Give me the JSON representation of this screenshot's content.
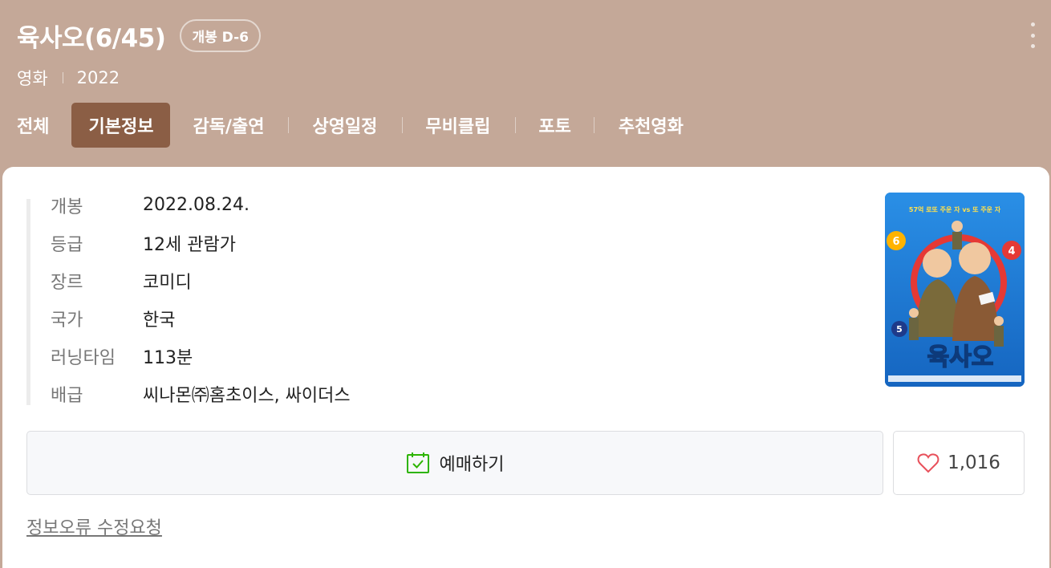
{
  "header": {
    "title": "육사오(6/45)",
    "dday_badge": "개봉 D-6",
    "category": "영화",
    "year": "2022"
  },
  "tabs": [
    {
      "label": "전체",
      "active": false
    },
    {
      "label": "기본정보",
      "active": true
    },
    {
      "label": "감독/출연",
      "active": false
    },
    {
      "label": "상영일정",
      "active": false
    },
    {
      "label": "무비클립",
      "active": false
    },
    {
      "label": "포토",
      "active": false
    },
    {
      "label": "추천영화",
      "active": false
    }
  ],
  "info": [
    {
      "label": "개봉",
      "value": "2022.08.24."
    },
    {
      "label": "등급",
      "value": "12세 관람가"
    },
    {
      "label": "장르",
      "value": "코미디"
    },
    {
      "label": "국가",
      "value": "한국"
    },
    {
      "label": "러닝타임",
      "value": "113분"
    },
    {
      "label": "배급",
      "value": "씨나몬㈜홈초이스, 싸이더스"
    }
  ],
  "poster": {
    "tagline": "57억 로또 주운 자 vs 또 주운 자",
    "title": "육사오",
    "balls": [
      "6",
      "4",
      "5"
    ]
  },
  "actions": {
    "reserve_label": "예매하기",
    "like_count": "1,016",
    "report_link": "정보오류 수정요청"
  },
  "colors": {
    "header_bg": "#c4a898",
    "active_tab": "#8b5e45",
    "reserve_icon": "#2db400",
    "heart": "#e8505b"
  },
  "icons": {
    "more": "more-vertical-icon",
    "reserve": "calendar-check-icon",
    "like": "heart-icon"
  }
}
